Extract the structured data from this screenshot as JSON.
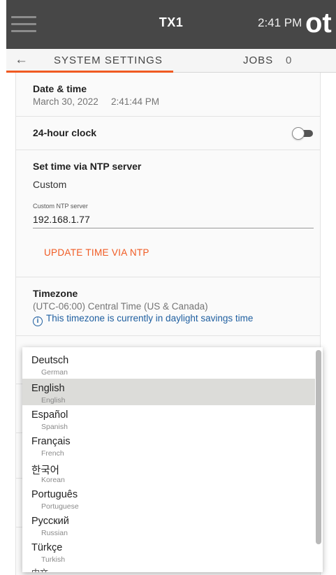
{
  "appbar": {
    "title": "TX1",
    "time": "2:41 PM",
    "brand": "ot",
    "menu_icon": "hamburger-menu-icon"
  },
  "nav": {
    "back_icon": "arrow-left-icon",
    "back_glyph": "←",
    "tab_label": "SYSTEM SETTINGS",
    "jobs_label": "JOBS",
    "jobs_count": "0",
    "accent_color": "#f05a22"
  },
  "settings": {
    "date_time": {
      "label": "Date & time",
      "date": "March 30, 2022",
      "time": "2:41:44 PM"
    },
    "clock24": {
      "label": "24-hour clock",
      "enabled": false
    },
    "ntp": {
      "label": "Set time via NTP server",
      "mode": "Custom",
      "field_caption": "Custom NTP server",
      "field_value": "192.168.1.77",
      "update_button": "UPDATE TIME VIA NTP"
    },
    "timezone": {
      "label": "Timezone",
      "value": "(UTC-06:00) Central Time (US & Canada)",
      "dst_icon": "info-circle-icon",
      "dst_note": "This timezone is currently in daylight savings time"
    }
  },
  "language_dropdown": {
    "selected": "English",
    "options": [
      {
        "name": "Deutsch",
        "sub": "German"
      },
      {
        "name": "English",
        "sub": "English"
      },
      {
        "name": "Español",
        "sub": "Spanish"
      },
      {
        "name": "Français",
        "sub": "French"
      },
      {
        "name": "한국어",
        "sub": "Korean"
      },
      {
        "name": "Português",
        "sub": "Portuguese"
      },
      {
        "name": "Русский",
        "sub": "Russian"
      },
      {
        "name": "Türkçe",
        "sub": "Turkish"
      }
    ],
    "partial_next": "中文"
  }
}
